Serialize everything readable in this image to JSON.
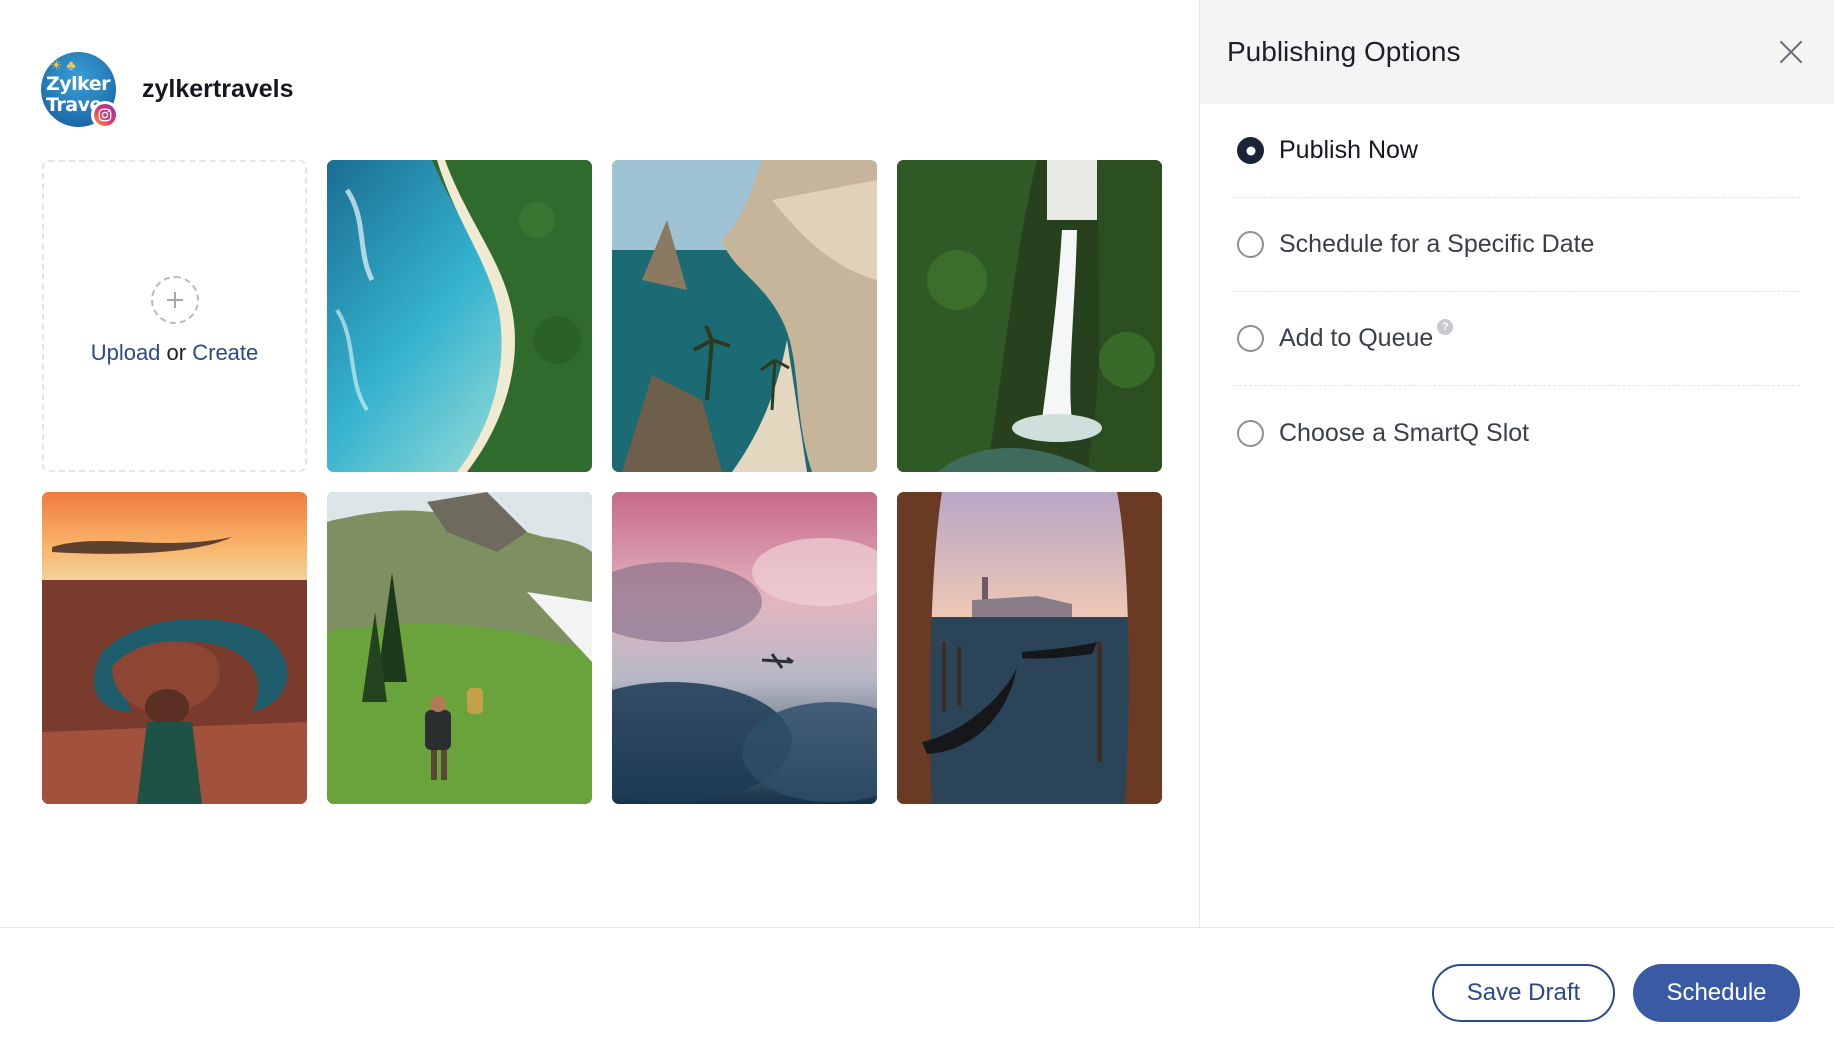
{
  "account": {
    "name": "zylkertravels",
    "logo_line1": "Zylker",
    "logo_line2": "Trave",
    "network_icon": "instagram-icon"
  },
  "media": {
    "upload_link": "Upload",
    "or_text": "or",
    "create_link": "Create",
    "photos": [
      "tropical-coast-aerial-photo",
      "sea-cliffs-beach-photo",
      "jungle-waterfall-photo",
      "canyon-sunset-photo",
      "mountain-hikers-photo",
      "airplane-clouds-photo",
      "venice-gondolas-photo"
    ]
  },
  "panel": {
    "title": "Publishing Options",
    "options": [
      {
        "label": "Publish Now",
        "selected": true
      },
      {
        "label": "Schedule for a Specific Date",
        "selected": false
      },
      {
        "label": "Add to Queue",
        "selected": false,
        "help": "?"
      },
      {
        "label": "Choose a SmartQ Slot",
        "selected": false
      }
    ]
  },
  "footer": {
    "save_draft": "Save Draft",
    "schedule": "Schedule"
  },
  "colors": {
    "accent": "#3a5aa4",
    "link": "#2b4a8b",
    "panel_header_bg": "#f4f4f5"
  }
}
